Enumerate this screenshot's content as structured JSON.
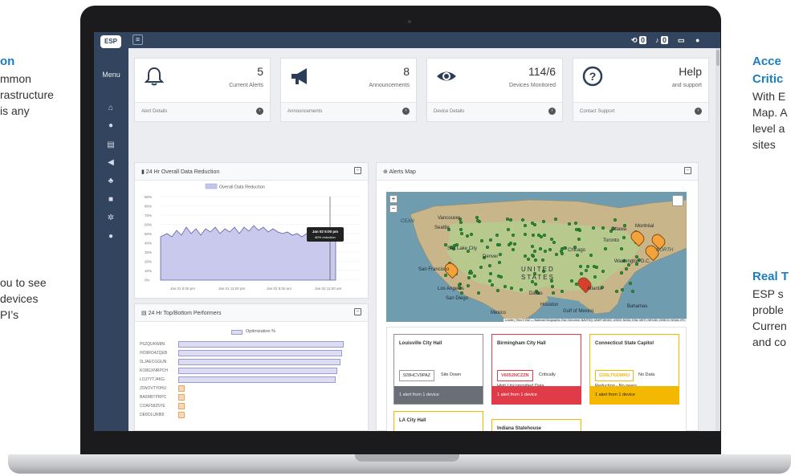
{
  "left_text": {
    "top_heading": "on",
    "top_lines": [
      "mmon",
      "rastructure",
      " is any"
    ],
    "bottom_lines": [
      "ou to see",
      " devices",
      "PI’s"
    ]
  },
  "right_text": {
    "top_heading_lines": [
      "Acce",
      "Critic"
    ],
    "top_lines": [
      "With E",
      "Map. A",
      "level a",
      "sites"
    ],
    "bottom_heading": "Real T",
    "bottom_lines": [
      "ESP s",
      "proble",
      "Curren",
      "and co"
    ]
  },
  "app": {
    "logo": "ESP",
    "menu_label": "Menu",
    "topbar": {
      "badge_1": "0",
      "badge_2": "0"
    },
    "cards": [
      {
        "icon": "bell-icon",
        "value": "5",
        "label": "Current Alerts",
        "footer": "Alert Details"
      },
      {
        "icon": "megaphone-icon",
        "value": "8",
        "label": "Announcements",
        "footer": "Announcements"
      },
      {
        "icon": "eye-icon",
        "value": "114/6",
        "label": "Devices Monitored",
        "footer": "Device Details"
      },
      {
        "icon": "question-icon",
        "value": "Help",
        "label": "and support",
        "footer": "Contact Support"
      }
    ],
    "reduction_panel": {
      "title": "24 Hr Overall Data Reduction",
      "legend": "Overall Data Reduction",
      "tooltip_time": "Jan 02 5:00 pm",
      "tooltip_value": "80% reduction",
      "y_ticks": [
        "90%",
        "80%",
        "70%",
        "60%",
        "50%",
        "40%",
        "30%",
        "20%",
        "10%",
        "0%"
      ],
      "x_ticks": [
        "Jan 01 5:00 pm",
        "Jan 01 11:00 pm",
        "Jan 02 5:00 am",
        "Jan 02 11:00 am"
      ]
    },
    "performers_panel": {
      "title": "24 Hr Top/Bottom Performers",
      "legend": "Optimization %",
      "rows": [
        {
          "label": "P6ZQUKW8N",
          "value": 100
        },
        {
          "label": "HO9RO4ZQEB",
          "value": 99
        },
        {
          "label": "0LJAECGGUN",
          "value": 98
        },
        {
          "label": "KO8GXNRPCH",
          "value": 96
        },
        {
          "label": "LOJ7YTJ4KG",
          "value": 95
        },
        {
          "label": "Z5NOVTY0HU",
          "value": 1
        },
        {
          "label": "BA0RBTPRPC",
          "value": 1
        },
        {
          "label": "COAF5825YE",
          "value": 1
        },
        {
          "label": "DE8OLUR80I",
          "value": 1
        }
      ]
    },
    "map_panel": {
      "title": "Alerts Map",
      "zoom_in": "+",
      "zoom_out": "−",
      "labels": {
        "ocean": "CEAN",
        "north": "NORTH",
        "united": "UNITED",
        "states": "STATES",
        "seattle": "Seattle",
        "vancouver": "Vancouver",
        "sf": "San Francisco",
        "la": "Los Angeles",
        "sandiego": "San Diego",
        "denver": "Denver",
        "saltlake": "Salt Lake City",
        "ottawa": "Ottawa",
        "montreal": "Montréal",
        "toronto": "Toronto",
        "chicago": "Chicago",
        "washington": "Washington D.C.",
        "dallas": "Dallas",
        "houston": "Houston",
        "atlanta": "Atlanta",
        "gulf": "Gulf of Mexico",
        "mexico": "Mexico",
        "bahamas": "Bahamas"
      },
      "attribution": "Leaflet | Tiles © Esri — National Geographic, Esri, DeLorme, NAVTEQ, UNEP-WCMC, USGS, NASA, ESA, METI, NRCAN, GEBCO, NOAA, iPC"
    },
    "sites": [
      {
        "name": "Louisville City Hall",
        "device": "928HCV9PAZ",
        "status": "Site Down",
        "footer": "1 alert from 1 device",
        "theme": "gray"
      },
      {
        "name": "Birmingham City Hall",
        "device": "V6052NCZZN",
        "status": "Critically",
        "status2": "High Uncommitted Data",
        "footer": "1 alert from 1 device",
        "theme": "red"
      },
      {
        "name": "Connecticut State Capitol",
        "device": "GS6LTKEWRU",
        "status": "No Data",
        "status2": "Reduction - No peers",
        "footer": "1 alert from 1 device",
        "theme": "yellow"
      },
      {
        "name": "LA City Hall",
        "theme": "yellow"
      },
      {
        "name": "Indiana Statehouse",
        "theme": "yellow"
      }
    ],
    "colors": {
      "navy": "#33445e",
      "accent_blue": "#1a7fc0",
      "red": "#e03b48",
      "yellow": "#f5b800",
      "gray": "#6a6f77"
    }
  }
}
